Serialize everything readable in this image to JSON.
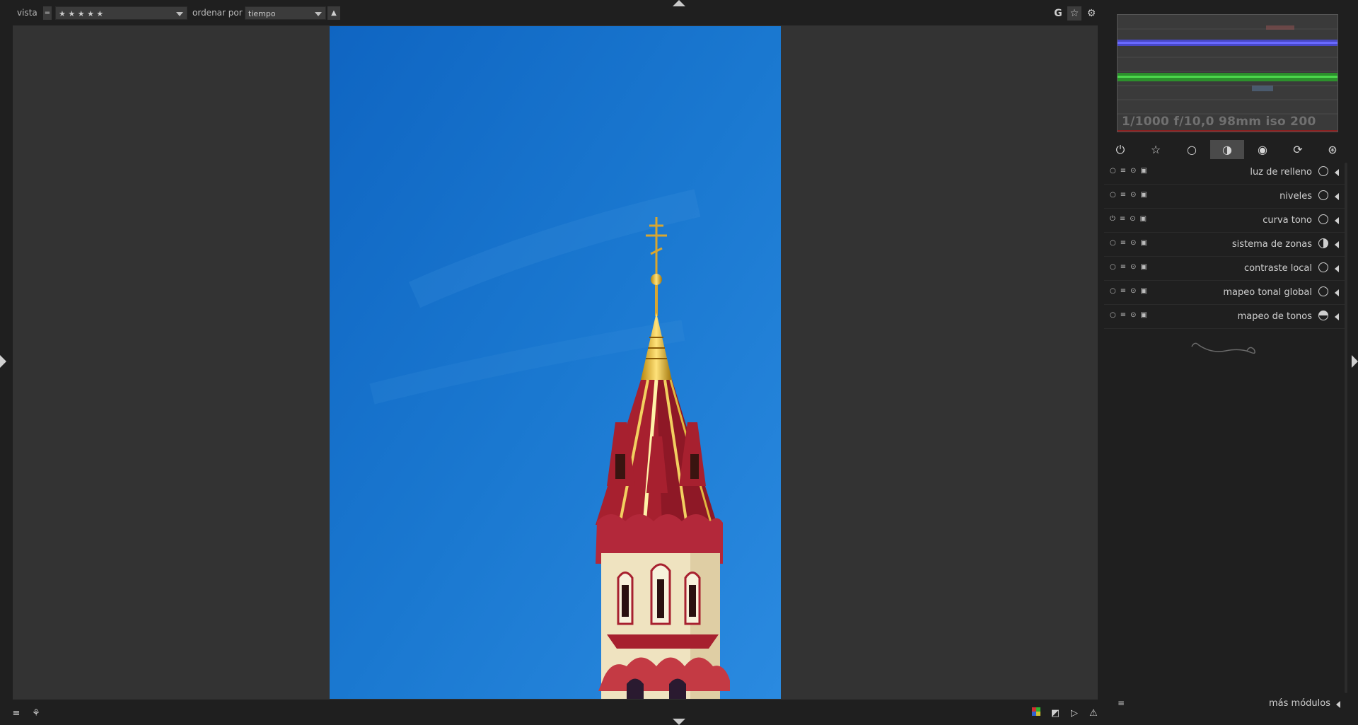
{
  "topbar": {
    "view_label": "vista",
    "compare_operator": "=",
    "rating_filter": "★ ★ ★ ★ ★",
    "sort_label": "ordenar por",
    "sort_value": "tiempo",
    "sort_direction_icon": "▲",
    "right_icons": [
      "grouping-icon",
      "star-overlay-icon",
      "gear-icon"
    ],
    "grouping_glyph": "G"
  },
  "histogram": {
    "exif_info": "1/1000 f/10,0 98mm iso 200"
  },
  "module_groups": [
    {
      "name": "active-modules",
      "glyph": "⏻"
    },
    {
      "name": "favorites",
      "glyph": "☆"
    },
    {
      "name": "basic",
      "glyph": "○"
    },
    {
      "name": "tone",
      "glyph": "◑"
    },
    {
      "name": "color",
      "glyph": "◉"
    },
    {
      "name": "correct",
      "glyph": "⟳"
    },
    {
      "name": "effect",
      "glyph": "⊛"
    }
  ],
  "active_group": "tone",
  "modules": [
    {
      "label": "luz de relleno",
      "enabled": false
    },
    {
      "label": "niveles",
      "enabled": false
    },
    {
      "label": "curva tono",
      "enabled": true
    },
    {
      "label": "sistema de zonas",
      "enabled": false
    },
    {
      "label": "contraste local",
      "enabled": false
    },
    {
      "label": "mapeo tonal global",
      "enabled": false
    },
    {
      "label": "mapeo de tonos",
      "enabled": false
    }
  ],
  "more_modules_label": "más módulos",
  "colors": {
    "background": "#1f1f1f",
    "center": "#333333",
    "sky": "#1a73c9"
  }
}
